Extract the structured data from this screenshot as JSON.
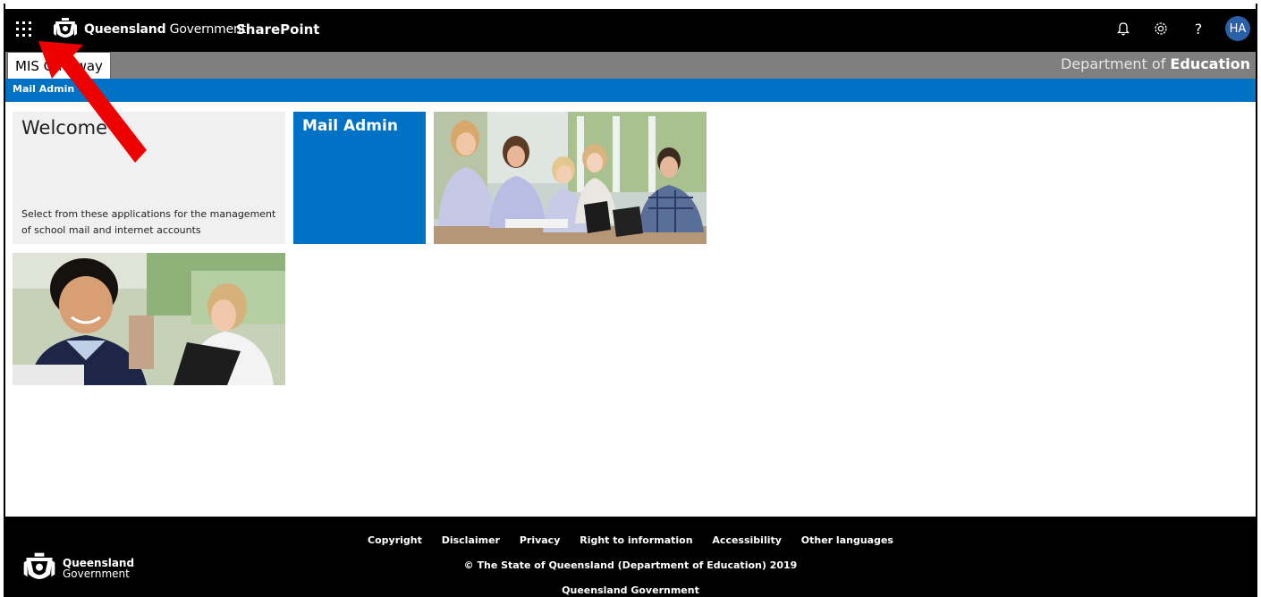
{
  "suitebar": {
    "brand_bold": "Queensland",
    "brand_rest": "Government",
    "app_title": "SharePoint",
    "icons": [
      "waffle-icon",
      "bell-icon",
      "gear-icon",
      "help-icon"
    ],
    "help_glyph": "?",
    "avatar_initials": "HA"
  },
  "site": {
    "tab_label": "MIS Gateway",
    "dept_prefix": "Department of",
    "dept_bold": "Education"
  },
  "nav": {
    "item": "Mail Admin"
  },
  "tiles": {
    "welcome_title": "Welcome",
    "welcome_text": "Select from these applications for the management of school mail and internet accounts",
    "mail_admin": "Mail Admin"
  },
  "footer": {
    "links": [
      "Copyright",
      "Disclaimer",
      "Privacy",
      "Right to information",
      "Accessibility",
      "Other languages"
    ],
    "copyright": "© The State of Queensland (Department of Education) 2019",
    "qgov": "Queensland Government",
    "logo_line1": "Queensland",
    "logo_line2": "Government"
  },
  "colors": {
    "suitebar": "#000000",
    "site_header": "#7f7f7f",
    "nav_blue": "#0072c6",
    "annotation_arrow": "#ee0000"
  }
}
